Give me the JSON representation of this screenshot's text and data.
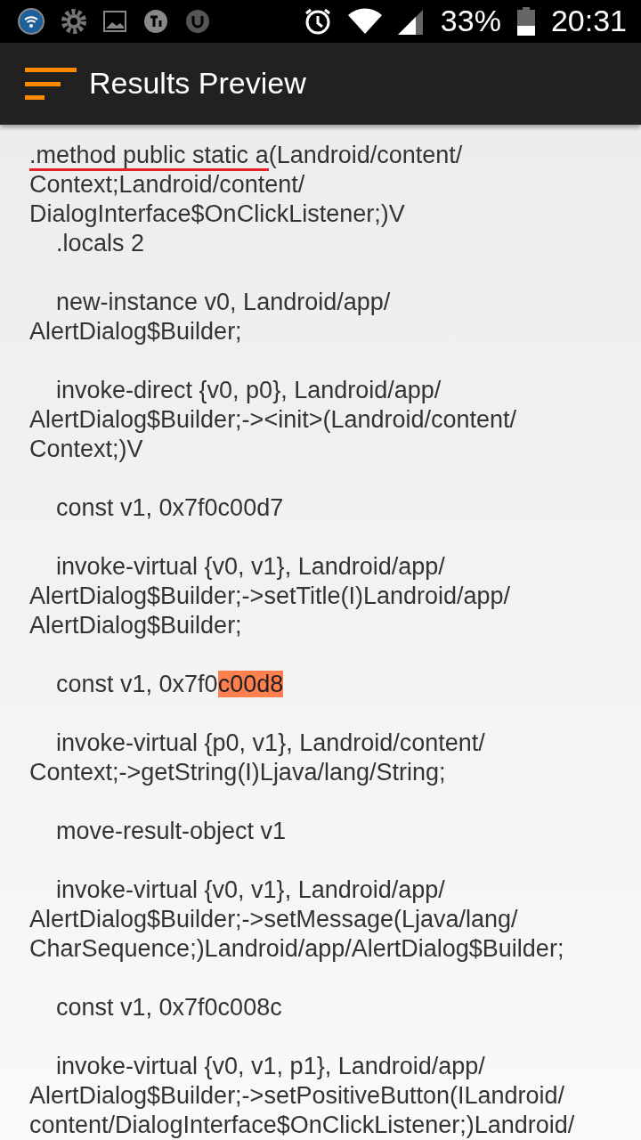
{
  "status_bar": {
    "battery": "33%",
    "time": "20:31"
  },
  "app_bar": {
    "title": "Results Preview"
  },
  "code_blocks": [
    {
      "lines": [
        [
          {
            "kind": "underline",
            "text": ".method public static a"
          },
          {
            "kind": "plain",
            "text": "(Landroid/content/"
          }
        ],
        [
          {
            "kind": "plain",
            "text": "Context;Landroid/content/"
          }
        ],
        [
          {
            "kind": "plain",
            "text": "DialogInterface$OnClickListener;)V"
          }
        ],
        [
          {
            "kind": "plain",
            "text": "    .locals 2"
          }
        ]
      ]
    },
    {
      "lines": [
        [
          {
            "kind": "plain",
            "text": "    new-instance v0, Landroid/app/"
          }
        ],
        [
          {
            "kind": "plain",
            "text": "AlertDialog$Builder;"
          }
        ]
      ]
    },
    {
      "lines": [
        [
          {
            "kind": "plain",
            "text": "    invoke-direct {v0, p0}, Landroid/app/"
          }
        ],
        [
          {
            "kind": "plain",
            "text": "AlertDialog$Builder;-><init>(Landroid/content/"
          }
        ],
        [
          {
            "kind": "plain",
            "text": "Context;)V"
          }
        ]
      ]
    },
    {
      "lines": [
        [
          {
            "kind": "plain",
            "text": "    const v1, 0x7f0c00d7"
          }
        ]
      ]
    },
    {
      "lines": [
        [
          {
            "kind": "plain",
            "text": "    invoke-virtual {v0, v1}, Landroid/app/"
          }
        ],
        [
          {
            "kind": "plain",
            "text": "AlertDialog$Builder;->setTitle(I)Landroid/app/"
          }
        ],
        [
          {
            "kind": "plain",
            "text": "AlertDialog$Builder;"
          }
        ]
      ]
    },
    {
      "lines": [
        [
          {
            "kind": "plain",
            "text": "    const v1, 0x7f0"
          },
          {
            "kind": "highlight",
            "text": "c00d8"
          }
        ]
      ]
    },
    {
      "lines": [
        [
          {
            "kind": "plain",
            "text": "    invoke-virtual {p0, v1}, Landroid/content/"
          }
        ],
        [
          {
            "kind": "plain",
            "text": "Context;->getString(I)Ljava/lang/String;"
          }
        ]
      ]
    },
    {
      "lines": [
        [
          {
            "kind": "plain",
            "text": "    move-result-object v1"
          }
        ]
      ]
    },
    {
      "lines": [
        [
          {
            "kind": "plain",
            "text": "    invoke-virtual {v0, v1}, Landroid/app/"
          }
        ],
        [
          {
            "kind": "plain",
            "text": "AlertDialog$Builder;->setMessage(Ljava/lang/"
          }
        ],
        [
          {
            "kind": "plain",
            "text": "CharSequence;)Landroid/app/AlertDialog$Builder;"
          }
        ]
      ]
    },
    {
      "lines": [
        [
          {
            "kind": "plain",
            "text": "    const v1, 0x7f0c008c"
          }
        ]
      ]
    },
    {
      "lines": [
        [
          {
            "kind": "plain",
            "text": "    invoke-virtual {v0, v1, p1}, Landroid/app/"
          }
        ],
        [
          {
            "kind": "plain",
            "text": "AlertDialog$Builder;->setPositiveButton(ILandroid/"
          }
        ],
        [
          {
            "kind": "plain",
            "text": "content/DialogInterface$OnClickListener;)Landroid/"
          }
        ]
      ]
    }
  ]
}
